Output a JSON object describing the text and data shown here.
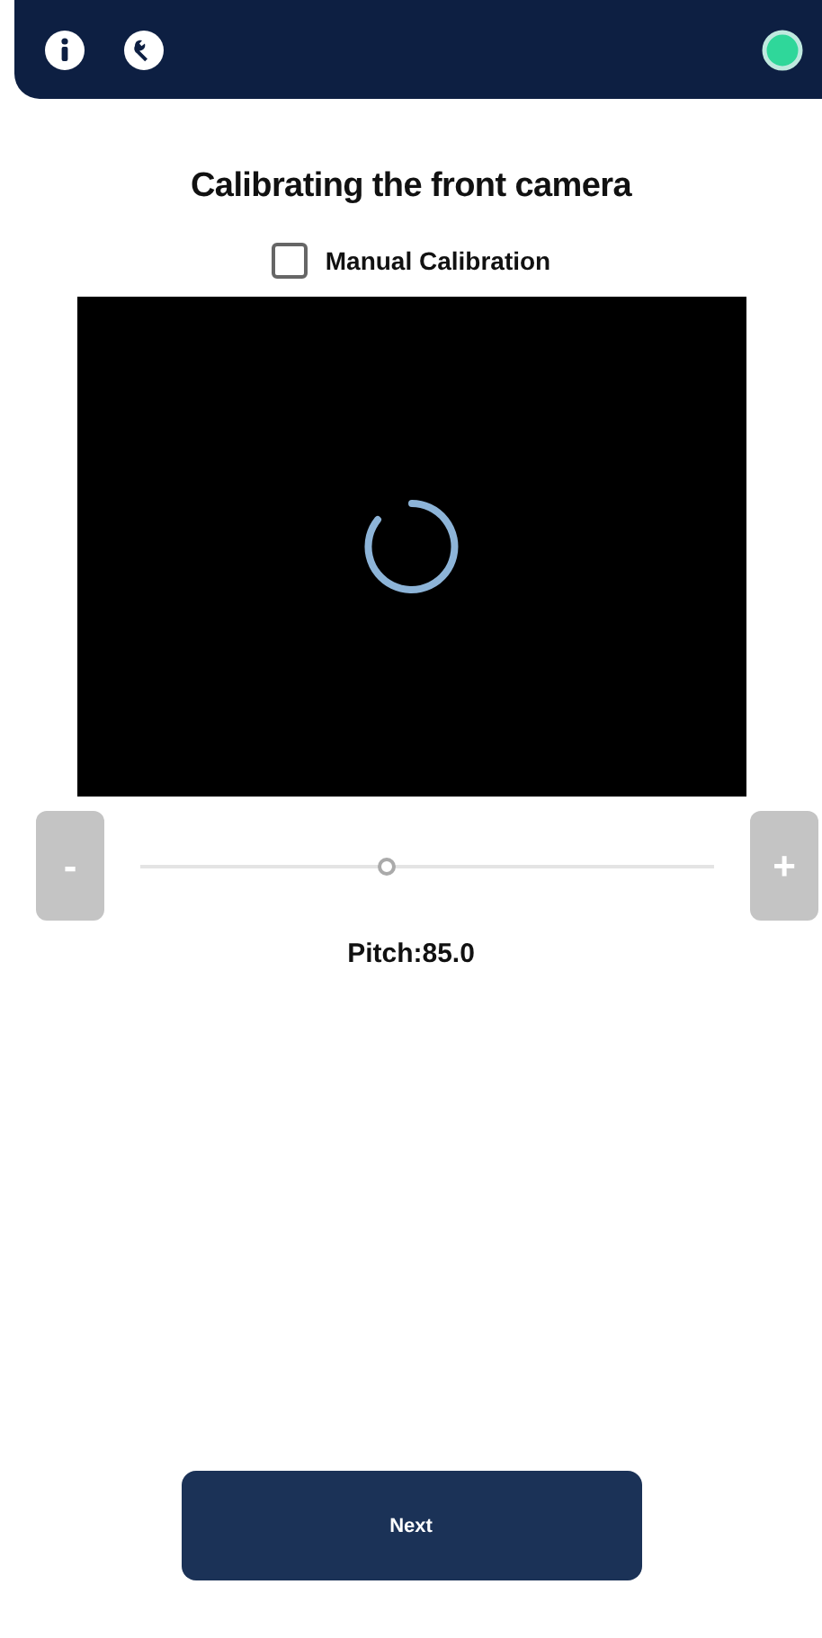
{
  "title": "Calibrating the front camera",
  "manual_calibration": {
    "label": "Manual Calibration",
    "checked": false
  },
  "pitch_slider": {
    "level": 0.43,
    "minus": {
      "label": "-",
      "disabled": true
    },
    "plus": {
      "label": "+",
      "disabled": true
    }
  },
  "pitch_reading": "Pitch:85.0",
  "next_button": {
    "label": "Next"
  }
}
